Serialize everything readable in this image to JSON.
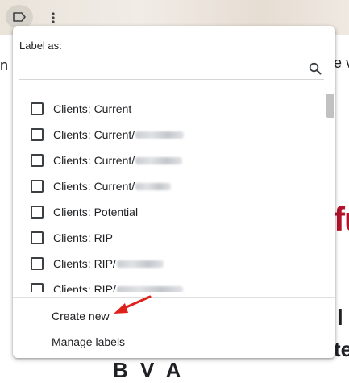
{
  "labels_menu": {
    "heading": "Label as:",
    "search": {
      "value": "",
      "placeholder": "",
      "icon": "search-icon"
    },
    "items": [
      {
        "label": "Clients: Current",
        "redacted": false,
        "checked": false
      },
      {
        "label": "Clients: Current/",
        "redacted": true,
        "checked": false
      },
      {
        "label": "Clients: Current/",
        "redacted": true,
        "checked": false
      },
      {
        "label": "Clients: Current/",
        "redacted": true,
        "checked": false
      },
      {
        "label": "Clients: Potential",
        "redacted": false,
        "checked": false
      },
      {
        "label": "Clients: RIP",
        "redacted": false,
        "checked": false
      },
      {
        "label": "Clients: RIP/",
        "redacted": true,
        "checked": false
      },
      {
        "label": "Clients: RIP/",
        "redacted": true,
        "checked": false
      }
    ],
    "create_new": "Create new",
    "manage_labels": "Manage labels"
  },
  "toolbar": {
    "label_icon": "label-icon",
    "more_icon": "more-vert-icon"
  },
  "background_text": {
    "fragment_n": "n",
    "fragment_ev": "e v",
    "fragment_fu": "fu",
    "fragment_l": "l",
    "fragment_te": "te",
    "fragment_bottom": "B      V     A"
  },
  "annotation": {
    "arrow_color": "#e0201b"
  },
  "colors": {
    "brand_red": "#b3122b",
    "text": "#202124"
  }
}
